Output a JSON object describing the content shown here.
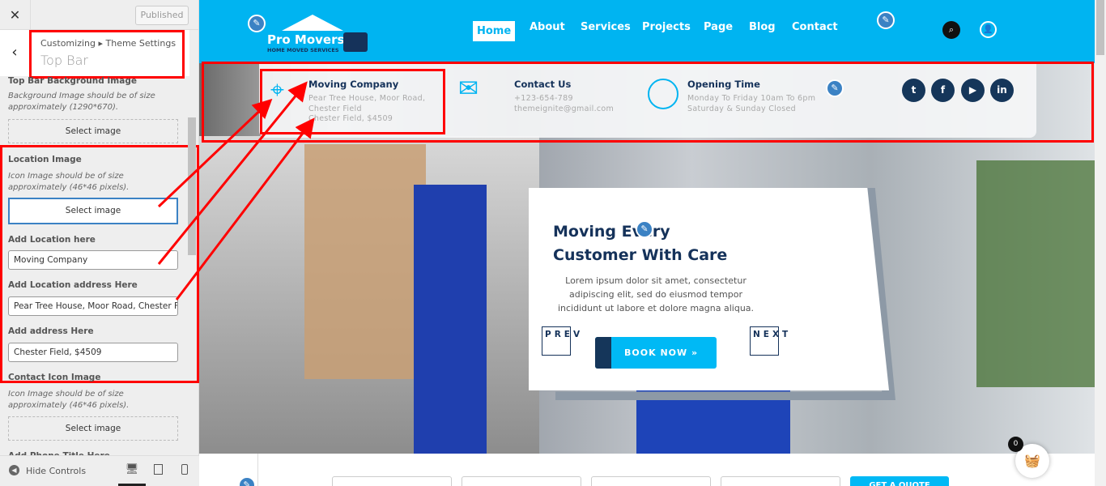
{
  "customizer": {
    "close_icon": "close-icon",
    "published_label": "Published",
    "breadcrumb": "Customizing ▸ Theme Settings",
    "section_title": "Top Bar",
    "fields": [
      {
        "label": "Top Bar Background Image",
        "description": "Background Image should be of size approximately (1290*670).",
        "button": "Select image"
      },
      {
        "label": "Location Image",
        "description": "Icon Image should be of size approximately (46*46 pixels).",
        "button": "Select image"
      },
      {
        "label": "Add Location here",
        "value": "Moving Company"
      },
      {
        "label": "Add Location address Here",
        "value": "Pear Tree House, Moor Road, Chester Field"
      },
      {
        "label": "Add address Here",
        "value": "Chester Field, $4509"
      },
      {
        "label": "Contact Icon Image",
        "description": "Icon Image should be of size approximately (46*46 pixels).",
        "button": "Select image"
      },
      {
        "label": "Add Phone Title Here"
      }
    ],
    "hide_controls": "Hide Controls"
  },
  "site": {
    "logo": {
      "title": "Pro Movers",
      "tagline": "HOME MOVED SERVICES"
    },
    "nav": [
      "Home",
      "About",
      "Services",
      "Projects",
      "Page",
      "Blog",
      "Contact"
    ],
    "active_nav": "Home",
    "topbar": {
      "location": {
        "title": "Moving Company",
        "line1": "Pear Tree House, Moor Road,",
        "line2": "Chester Field",
        "line3": "Chester Field, $4509"
      },
      "contact": {
        "title": "Contact Us",
        "phone": "+123-654-789",
        "email": "themeignite@gmail.com"
      },
      "hours": {
        "title": "Opening Time",
        "line1": "Monday To Friday 10am To 6pm",
        "line2": "Saturday & Sunday Closed"
      },
      "social": [
        "twitter",
        "facebook",
        "youtube",
        "linkedin"
      ]
    },
    "hero": {
      "title_line1": "Moving Every",
      "title_line2": "Customer With Care",
      "text": "Lorem ipsum dolor sit amet, consectetur adipiscing elit, sed do eiusmod tempor incididunt ut labore et dolore magna aliqua.",
      "prev": "PREV",
      "next": "NEXT",
      "button": "BOOK NOW »"
    },
    "quote_button": "GET A QUOTE",
    "cart_count": "0"
  },
  "colors": {
    "brand": "#00b4f1",
    "navy": "#15325a",
    "annotation": "#ff0000"
  }
}
